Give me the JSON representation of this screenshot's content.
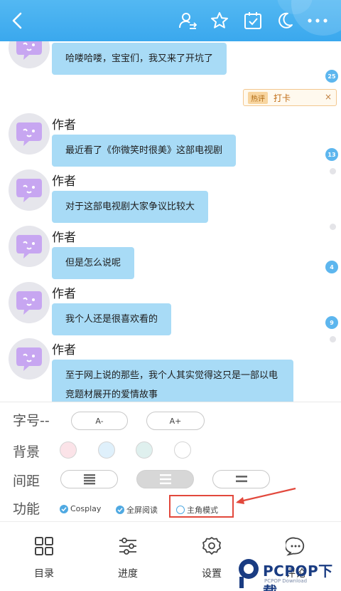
{
  "header": {
    "icons": [
      "back-icon",
      "user-transfer-icon",
      "star-icon",
      "calendar-check-icon",
      "moon-icon",
      "more-icon"
    ]
  },
  "messages": [
    {
      "author": "",
      "text": "哈喽哈喽，宝宝们，我又来了开坑了"
    },
    {
      "author": "作者",
      "text": "最近看了《你微笑时很美》这部电视剧"
    },
    {
      "author": "作者",
      "text": "对于这部电视剧大家争议比较大"
    },
    {
      "author": "作者",
      "text": "但是怎么说呢"
    },
    {
      "author": "作者",
      "text": "我个人还是很喜欢看的"
    },
    {
      "author": "作者",
      "text": "至于网上说的那些，我个人其实觉得这只是一部以电竞题材展开的爱情故事"
    }
  ],
  "side_counts": [
    "25",
    "13",
    "4",
    "9"
  ],
  "hot_comment": {
    "tag": "热评",
    "text": "打卡",
    "close": "×"
  },
  "settings": {
    "font_label": "字号--",
    "font_decrease": "A-",
    "font_increase": "A+",
    "bg_label": "背景",
    "bg_colors": [
      "#fbe3e8",
      "#dff0fb",
      "#dff0ee",
      "#ffffff"
    ],
    "spacing_label": "间距",
    "func_label": "功能",
    "func_options": [
      {
        "label": "Cosplay",
        "checked": true
      },
      {
        "label": "全屏阅读",
        "checked": true
      },
      {
        "label": "主角模式",
        "checked": false
      }
    ]
  },
  "nav": [
    {
      "label": "目录",
      "icon": "grid-icon"
    },
    {
      "label": "进度",
      "icon": "sliders-icon"
    },
    {
      "label": "设置",
      "icon": "gear-icon"
    },
    {
      "label": "评论",
      "icon": "chat-icon"
    }
  ],
  "watermark": {
    "title": "PCPOP下载",
    "sub": "PCPOP Download"
  }
}
